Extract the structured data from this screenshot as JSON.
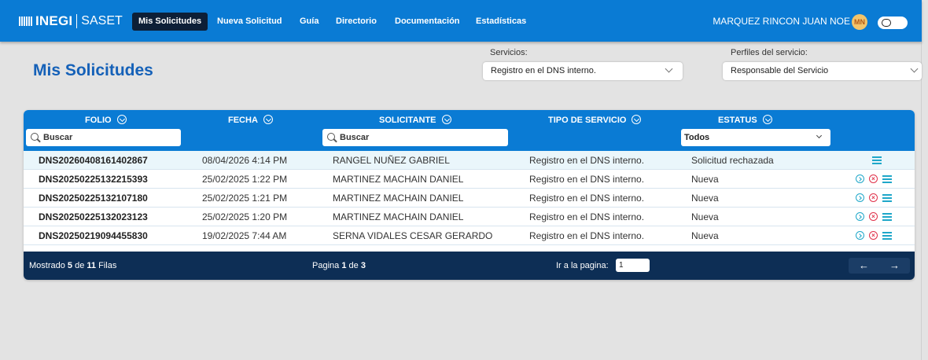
{
  "app": {
    "brand": "INEGI",
    "app_name": "SASET"
  },
  "nav": {
    "items": [
      {
        "label": "Mis Solicitudes",
        "active": true
      },
      {
        "label": "Nueva Solicitud"
      },
      {
        "label": "Guía"
      },
      {
        "label": "Directorio"
      },
      {
        "label": "Documentación"
      },
      {
        "label": "Estadísticas"
      }
    ],
    "user_name": "MARQUEZ RINCON JUAN NOE",
    "avatar_initials": "MN"
  },
  "page": {
    "title": "Mis Solicitudes",
    "filters": {
      "servicios_label": "Servicios:",
      "servicios_value": "Registro en el DNS interno.",
      "perfiles_label": "Perfiles del servicio:",
      "perfiles_value": "Responsable del Servicio"
    }
  },
  "table": {
    "headers": [
      "FOLIO",
      "FECHA",
      "SOLICITANTE",
      "TIPO DE SERVICIO",
      "ESTATUS"
    ],
    "search_placeholder": "Buscar",
    "status_filter": "Todos",
    "rows": [
      {
        "folio": "DNS20260408161402867",
        "fecha": "08/04/2026 4:14 PM",
        "solicitante": "RANGEL NUÑEZ GABRIEL",
        "tipo": "Registro en el DNS interno.",
        "estatus": "Solicitud rechazada",
        "actions": [
          "list-icon"
        ]
      },
      {
        "folio": "DNS20250225132215393",
        "fecha": "25/02/2025 1:22 PM",
        "solicitante": "MARTINEZ MACHAIN DANIEL",
        "tipo": "Registro en el DNS interno.",
        "estatus": "Nueva",
        "actions": [
          "go-icon",
          "cancel-icon",
          "list-icon"
        ]
      },
      {
        "folio": "DNS20250225132107180",
        "fecha": "25/02/2025 1:21 PM",
        "solicitante": "MARTINEZ MACHAIN DANIEL",
        "tipo": "Registro en el DNS interno.",
        "estatus": "Nueva",
        "actions": [
          "go-icon",
          "cancel-icon",
          "list-icon"
        ]
      },
      {
        "folio": "DNS20250225132023123",
        "fecha": "25/02/2025 1:20 PM",
        "solicitante": "MARTINEZ MACHAIN DANIEL",
        "tipo": "Registro en el DNS interno.",
        "estatus": "Nueva",
        "actions": [
          "go-icon",
          "cancel-icon",
          "list-icon"
        ]
      },
      {
        "folio": "DNS20250219094455830",
        "fecha": "19/02/2025 7:44 AM",
        "solicitante": "SERNA VIDALES CESAR GERARDO",
        "tipo": "Registro en el DNS interno.",
        "estatus": "Nueva",
        "actions": [
          "go-icon",
          "cancel-icon",
          "list-icon"
        ]
      }
    ],
    "footer": {
      "shown_prefix": "Mostrado",
      "shown_count": "5",
      "shown_mid": "de",
      "total": "11",
      "shown_suffix": "Filas",
      "page_prefix": "Pagina",
      "page_current": "1",
      "page_mid": "de",
      "page_total": "3",
      "goto_label": "Ir a la pagina:",
      "goto_value": "1",
      "prev": "←",
      "next": "→"
    }
  },
  "colors": {
    "primary": "#0a7bd4",
    "nav_active": "#0d1f37",
    "title": "#1561b8",
    "footer": "#0d2e55",
    "action_blue": "#1fa7c9",
    "action_red": "#e0314a"
  }
}
